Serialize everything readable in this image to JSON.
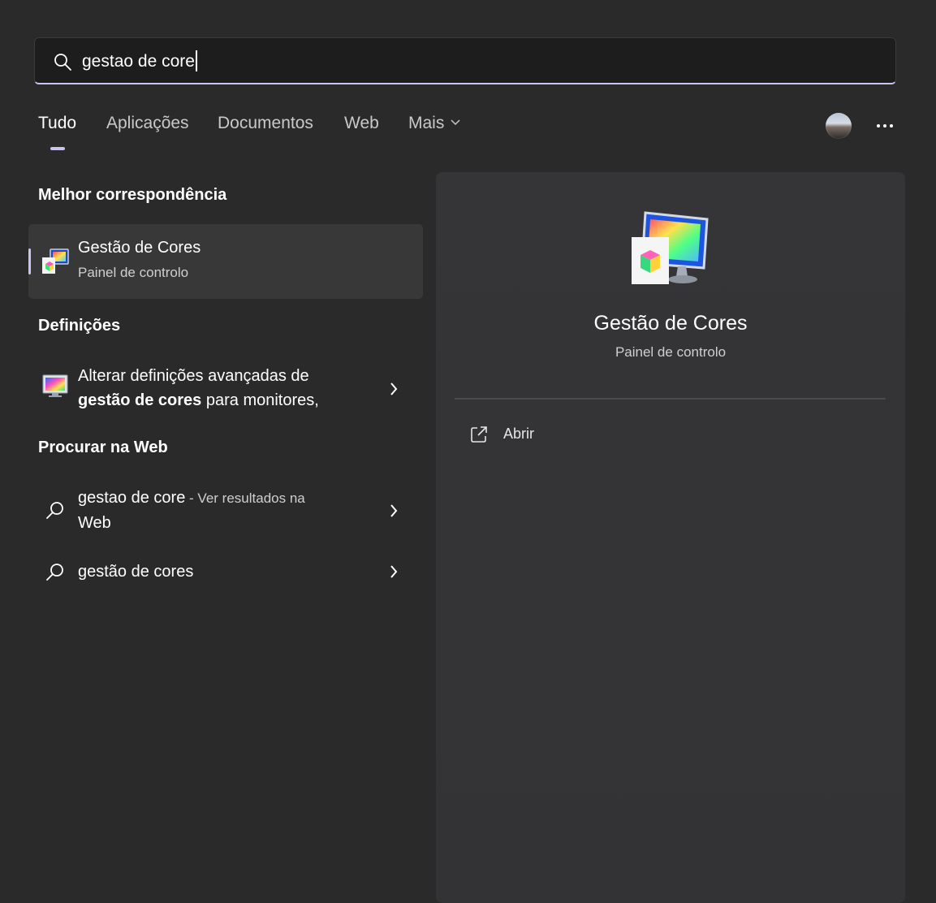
{
  "search": {
    "value": "gestao de core"
  },
  "tabs": [
    {
      "label": "Tudo",
      "active": true
    },
    {
      "label": "Aplicações",
      "active": false
    },
    {
      "label": "Documentos",
      "active": false
    },
    {
      "label": "Web",
      "active": false
    },
    {
      "label": "Mais",
      "active": false
    }
  ],
  "sections": {
    "best_match": "Melhor correspondência",
    "settings": "Definições",
    "web": "Procurar na Web"
  },
  "best_match": {
    "title": "Gestão de Cores",
    "subtitle": "Painel de controlo"
  },
  "settings_result": {
    "line1": "Alterar definições avançadas de",
    "line2_bold": "gestão de cores",
    "line2_rest": " para monitores,"
  },
  "web_results": [
    {
      "query": "gestao de core",
      "hint": " - Ver resultados na",
      "hint2": "Web"
    },
    {
      "query": "gestão de cores"
    }
  ],
  "detail": {
    "title": "Gestão de Cores",
    "subtitle": "Painel de controlo",
    "action_open": "Abrir"
  },
  "colors": {
    "accent": "#c9c3ef",
    "background": "#2a2a2b",
    "pane": "#353537"
  }
}
